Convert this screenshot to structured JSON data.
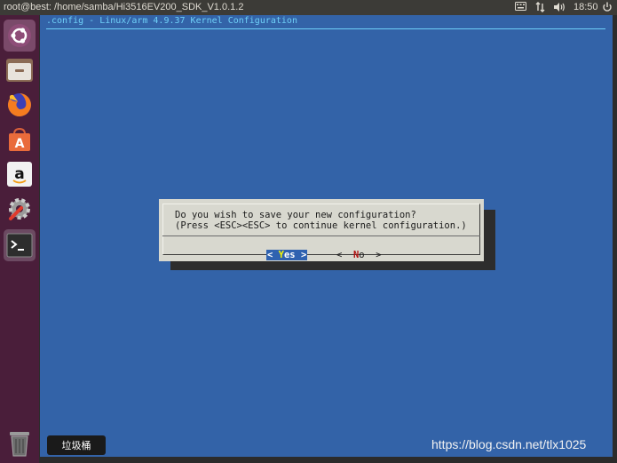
{
  "topbar": {
    "window_title": "root@best: /home/samba/Hi3516EV200_SDK_V1.0.1.2",
    "clock": "18:50",
    "tray_icons": [
      "keyboard-icon",
      "network-icon",
      "volume-icon",
      "power-icon"
    ]
  },
  "launcher": {
    "items": [
      {
        "name": "ubuntu-logo-icon"
      },
      {
        "name": "files-icon"
      },
      {
        "name": "firefox-icon"
      },
      {
        "name": "software-center-icon"
      },
      {
        "name": "amazon-icon"
      },
      {
        "name": "system-settings-icon"
      },
      {
        "name": "terminal-icon"
      },
      {
        "name": "trash-icon"
      }
    ],
    "trash_tooltip": "垃圾桶"
  },
  "terminal": {
    "header": ".config - Linux/arm 4.9.37 Kernel Configuration",
    "dialog": {
      "line1": "Do you wish to save your new configuration?",
      "line2": "(Press <ESC><ESC> to continue kernel configuration.)",
      "yes": {
        "left": "< ",
        "hot": "Y",
        "rest": "es >"
      },
      "no": {
        "left": "<  ",
        "hot": "N",
        "rest": "o  >"
      }
    }
  },
  "watermark": "https://blog.csdn.net/tlx1025",
  "colors": {
    "terminal_bg": "#3363a8",
    "dialog_bg": "#d8d8cf",
    "header_text": "#6fd0f8",
    "launcher_bg": "#4a1e3a"
  }
}
